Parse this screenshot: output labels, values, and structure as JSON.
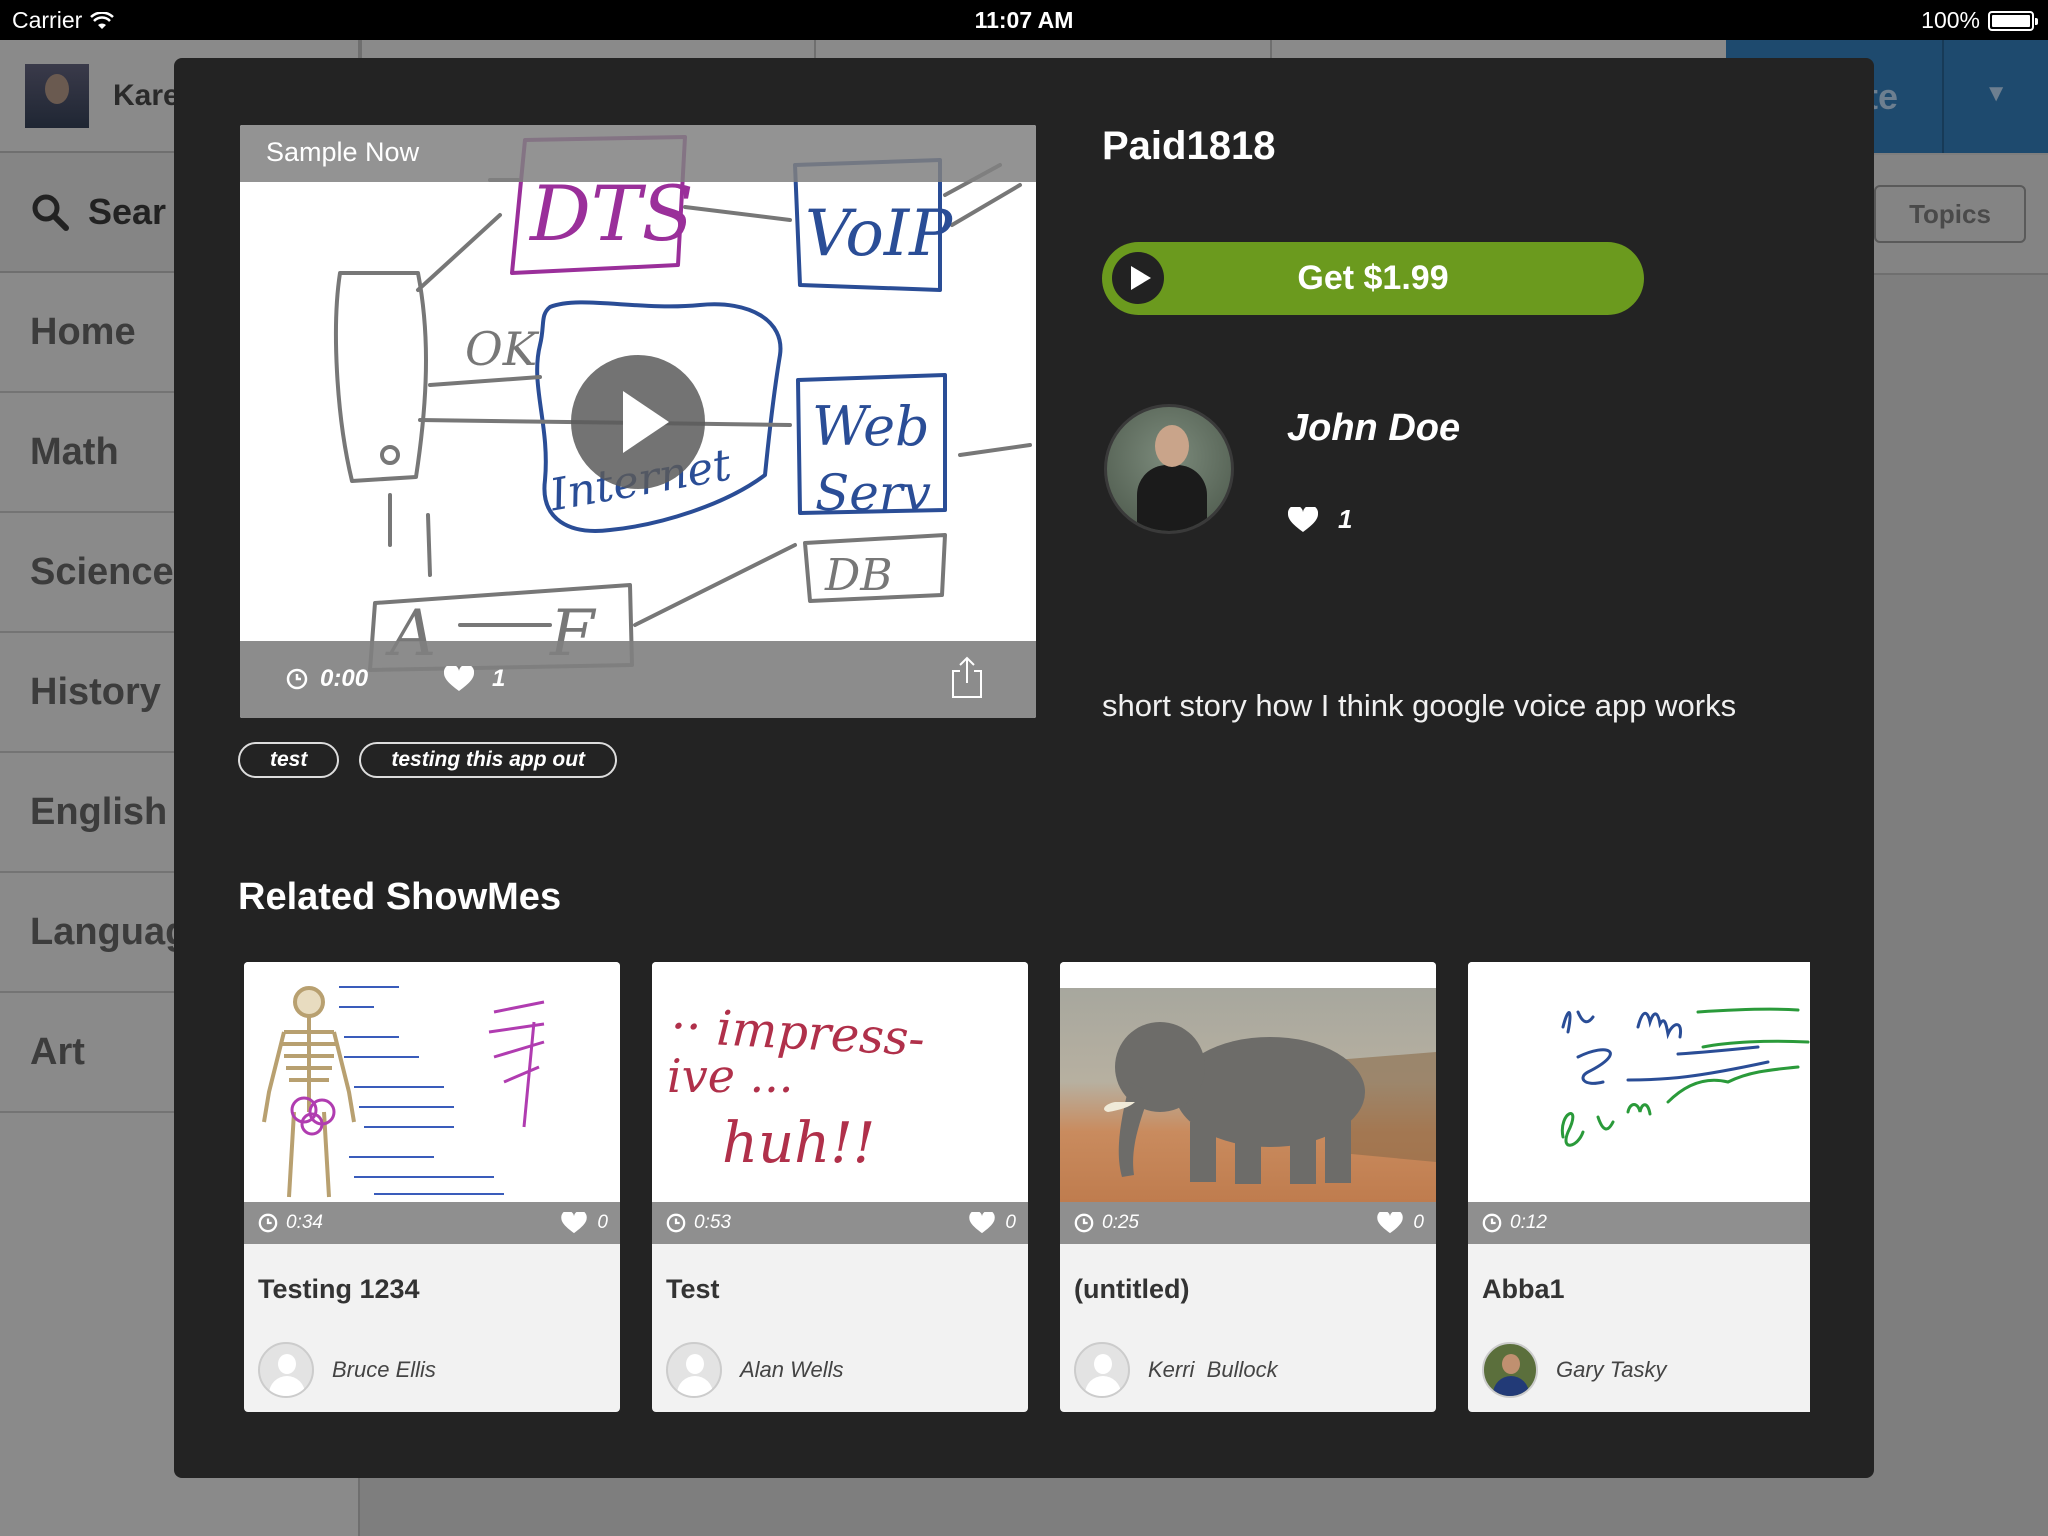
{
  "status_bar": {
    "carrier": "Carrier",
    "time": "11:07 AM",
    "battery": "100%"
  },
  "background": {
    "user_name": "Kare",
    "search_label": "Sear",
    "nav_items": [
      "Home",
      "Math",
      "Science",
      "History",
      "English",
      "Languag",
      "Art"
    ],
    "create_label": "te",
    "topics_label": "Topics"
  },
  "modal": {
    "video": {
      "sample_label": "Sample Now",
      "duration": "0:00",
      "likes": "1"
    },
    "tags": [
      "test",
      "testing this app out"
    ],
    "title": "Paid1818",
    "buy_button": "Get $1.99",
    "author": {
      "name": "John Doe",
      "likes": "1"
    },
    "description": "short story how I think google voice app works",
    "related_title": "Related ShowMes",
    "related": [
      {
        "title": "Testing 1234",
        "duration": "0:34",
        "likes": "0",
        "author": "Bruce Ellis"
      },
      {
        "title": "Test",
        "duration": "0:53",
        "likes": "0",
        "author": "Alan Wells"
      },
      {
        "title": "(untitled)",
        "duration": "0:25",
        "likes": "0",
        "author": "Kerri  Bullock"
      },
      {
        "title": "Abba1",
        "duration": "0:12",
        "likes": "",
        "author": "Gary Tasky"
      }
    ]
  },
  "colors": {
    "accent_green": "#6b9a1e",
    "modal_bg": "#232323",
    "create_blue": "#1e4a6e"
  },
  "icons": {
    "clock": "clock-icon",
    "heart": "heart-icon",
    "share": "share-icon",
    "play": "play-icon",
    "search": "search-icon"
  }
}
